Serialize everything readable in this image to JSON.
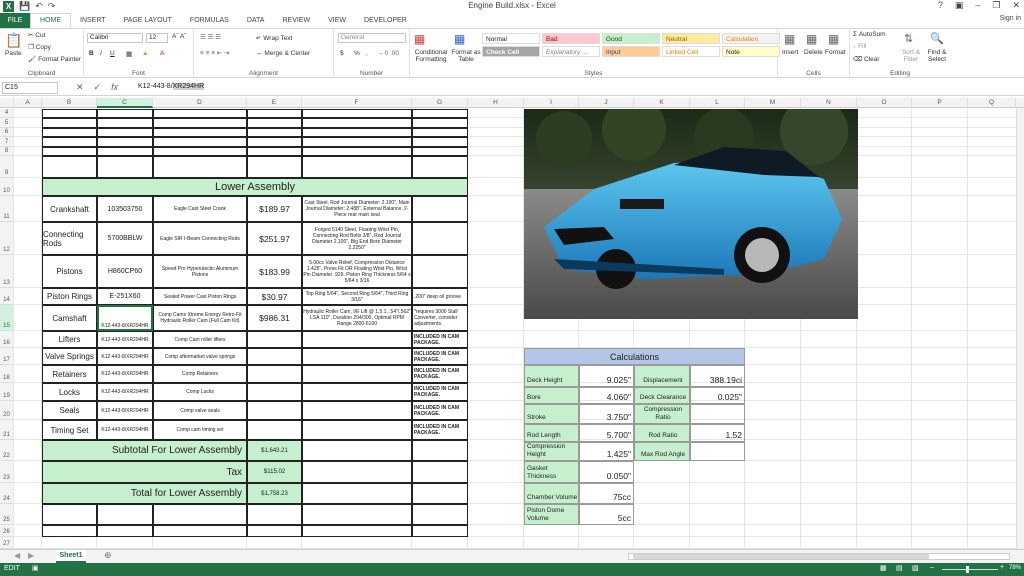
{
  "window": {
    "title": "Engine Build.xlsx - Excel",
    "signin": "Sign in",
    "help": "?"
  },
  "tabs": [
    "FILE",
    "HOME",
    "INSERT",
    "PAGE LAYOUT",
    "FORMULAS",
    "DATA",
    "REVIEW",
    "VIEW",
    "DEVELOPER"
  ],
  "ribbon": {
    "clipboard": {
      "label": "Clipboard",
      "paste": "Paste",
      "cut": "Cut",
      "copy": "Copy",
      "format_painter": "Format Painter"
    },
    "font": {
      "label": "Font",
      "name": "Calibri",
      "size": "12",
      "bold": "B",
      "italic": "I",
      "underline": "U"
    },
    "alignment": {
      "label": "Alignment",
      "wrap": "Wrap Text",
      "merge": "Merge & Center"
    },
    "number": {
      "label": "Number",
      "format": "General",
      "currency": "$",
      "percent": "%",
      "comma": ","
    },
    "styles": {
      "label": "Styles",
      "cond": "Conditional Formatting",
      "table": "Format as Table",
      "normal": "Normal",
      "bad": "Bad",
      "good": "Good",
      "neutral": "Neutral",
      "calculation": "Calculation",
      "check": "Check Cell",
      "explanatory": "Explanatory ...",
      "input": "Input",
      "linked": "Linked Cell",
      "note": "Note"
    },
    "cells": {
      "label": "Cells",
      "insert": "Insert",
      "delete": "Delete",
      "format": "Format"
    },
    "editing": {
      "label": "Editing",
      "autosum": "AutoSum",
      "fill": "Fill",
      "clear": "Clear",
      "sort": "Sort & Filter",
      "find": "Find & Select"
    }
  },
  "formula_bar": {
    "name_box": "C15",
    "fx": "fx",
    "formula_prefix": "K12-443-8/",
    "formula_selected": "XR294HR"
  },
  "columns": [
    "A",
    "B",
    "C",
    "D",
    "E",
    "F",
    "G",
    "H",
    "I",
    "J",
    "K",
    "L",
    "M",
    "N",
    "O",
    "P",
    "Q"
  ],
  "rows": [
    "4",
    "5",
    "6",
    "7",
    "8",
    "9",
    "10",
    "11",
    "12",
    "13",
    "14",
    "15",
    "16",
    "17",
    "18",
    "19",
    "20",
    "21",
    "22",
    "23",
    "24",
    "25",
    "26",
    "27"
  ],
  "lower_assembly": {
    "title": "Lower Assembly",
    "parts": [
      {
        "name": "Crankshaft",
        "part": "103503750",
        "desc": "Eagle Cast Steel Crank",
        "price": "$189.97",
        "notes": "Cast Steel, Rod Journal Diameter: 2.100\", Main Journal Diameter: 2.488\", External Balance, 2-Piece rear main seal",
        "extra": ""
      },
      {
        "name": "Connecting Rods",
        "part": "5700BBLW",
        "desc": "Eagle SIR I-Beam Connecting Rods",
        "price": "$251.97",
        "notes": "Forged 5140 Steel, Floating Wrist Pin, Connecting Rod Bolts 3/8\", Rod Journal Diameter 2.100\", Big End Bore Diameter 2.2250\"",
        "extra": ""
      },
      {
        "name": "Pistons",
        "part": "H860CP60",
        "desc": "Speed Pro Hyperutectic Aluminum Pistons",
        "price": "$183.99",
        "notes": "5.00cc Valve Relief, Compression Distance 1.425\", Press Fit OR Floating Wrist Pin, Wrist Pin Diameter .929, Piston Ring Thickness 5/64 x 5/64 x 3/16",
        "extra": ""
      },
      {
        "name": "Piston Rings",
        "part": "E-251X60",
        "desc": "Sealed Power Cast Piston Rings",
        "price": "$30.97",
        "notes": "Top Ring 5/64\", Second Ring 5/64\", Third Ring 3/16\"",
        "extra": ".200\" deep oil groove"
      },
      {
        "name": "Camshaft",
        "part": "K12-443-8/XR294HR",
        "desc": "Comp Cams Xtreme Energy Retro-Fit Hydraulic Roller Cam (Full Cam Kit)",
        "price": "$986.31",
        "notes": "Hydraulic Roller Cam, I/E Lift @ 1.5:1, .54\"/.562\" LSA 110\", Duration 294/300, Optimal RPM Range 2800-6100",
        "extra": "*requires 3000 Stall Converter, consider adjustments."
      },
      {
        "name": "Lifters",
        "part": "K12-443-8/XR294HR",
        "desc": "Comp Cam roller lifters",
        "price": "",
        "notes": "",
        "extra": "INCLUDED IN CAM PACKAGE."
      },
      {
        "name": "Valve Springs",
        "part": "K12-443-8/XR294HR",
        "desc": "Comp aftermarket valve springs",
        "price": "",
        "notes": "",
        "extra": "INCLUDED IN CAM PACKAGE."
      },
      {
        "name": "Retainers",
        "part": "K12-443-8/XR294HR",
        "desc": "Comp Retainers",
        "price": "",
        "notes": "",
        "extra": "INCLUDED IN CAM PACKAGE."
      },
      {
        "name": "Locks",
        "part": "K12-443-8/XR294HR",
        "desc": "Comp Locks",
        "price": "",
        "notes": "",
        "extra": "INCLUDED IN CAM PACKAGE."
      },
      {
        "name": "Seals",
        "part": "K12-443-8/XR294HR",
        "desc": "Comp valve seals",
        "price": "",
        "notes": "",
        "extra": "INCLUDED IN CAM PACKAGE."
      },
      {
        "name": "Timing Set",
        "part": "K12-443-8/XR294HR",
        "desc": "Comp cam timing set",
        "price": "",
        "notes": "",
        "extra": "INCLUDED IN CAM PACKAGE."
      }
    ],
    "subtotal_label": "Subtotal For Lower Assembly",
    "subtotal": "$1,643.21",
    "tax_label": "Tax",
    "tax": "$115.02",
    "total_label": "Total for Lower Assembly",
    "total": "$1,758.23"
  },
  "calculations": {
    "title": "Calculations",
    "left": [
      {
        "label": "Deck Height",
        "value": "9.025\""
      },
      {
        "label": "Bore",
        "value": "4.060\""
      },
      {
        "label": "Stroke",
        "value": "3.750\""
      },
      {
        "label": "Rod Length",
        "value": "5.700\""
      },
      {
        "label": "Compression Height",
        "value": "1.425\""
      },
      {
        "label": "Gasket Thickness",
        "value": "0.050\""
      },
      {
        "label": "Chamber Volume",
        "value": "75cc"
      },
      {
        "label": "Piston Dome Volume",
        "value": "5cc"
      }
    ],
    "right": [
      {
        "label": "Displacement",
        "value": "388.19ci"
      },
      {
        "label": "Deck Clearance",
        "value": "0.025\""
      },
      {
        "label": "Compression Ratio",
        "value": ""
      },
      {
        "label": "Rod Ratio",
        "value": "1.52"
      },
      {
        "label": "Max Rod Angle",
        "value": ""
      }
    ]
  },
  "sheet": {
    "tab": "Sheet1"
  },
  "status": {
    "mode": "EDIT",
    "zoom": "78%"
  },
  "colors": {
    "excel_green": "#217346",
    "cell_green": "#c6efce",
    "calc_blue": "#b4c6e7"
  }
}
